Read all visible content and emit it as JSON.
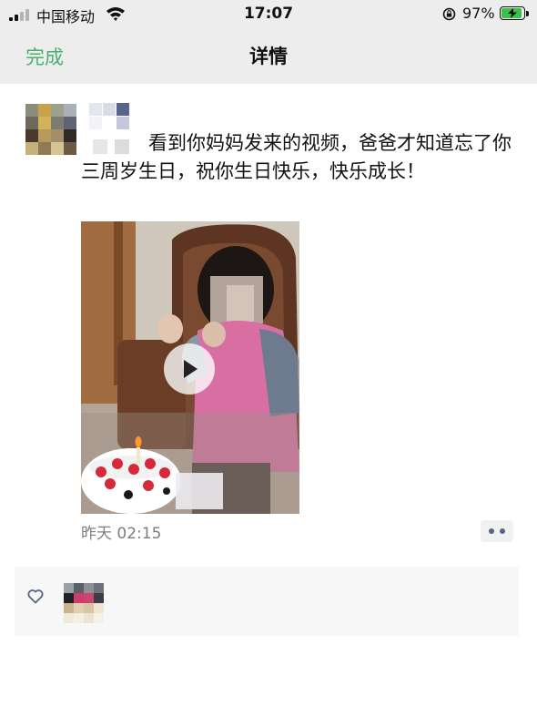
{
  "status_bar": {
    "carrier": "中国移动",
    "time": "17:07",
    "battery_percent": "97%",
    "battery_level": 0.97
  },
  "nav": {
    "done_label": "完成",
    "title": "详情"
  },
  "post": {
    "text": "看到你妈妈发来的视频，爸爸才知道忘了你三周岁生日，祝你生日快乐，快乐成长！",
    "timestamp": "昨天 02:15"
  },
  "colors": {
    "accent_green": "#4cae6f",
    "link_blue": "#56638a",
    "nav_bg": "#ededed"
  },
  "icons": {
    "like": "heart-icon",
    "video": "play-icon",
    "more": "more-dots-icon"
  }
}
